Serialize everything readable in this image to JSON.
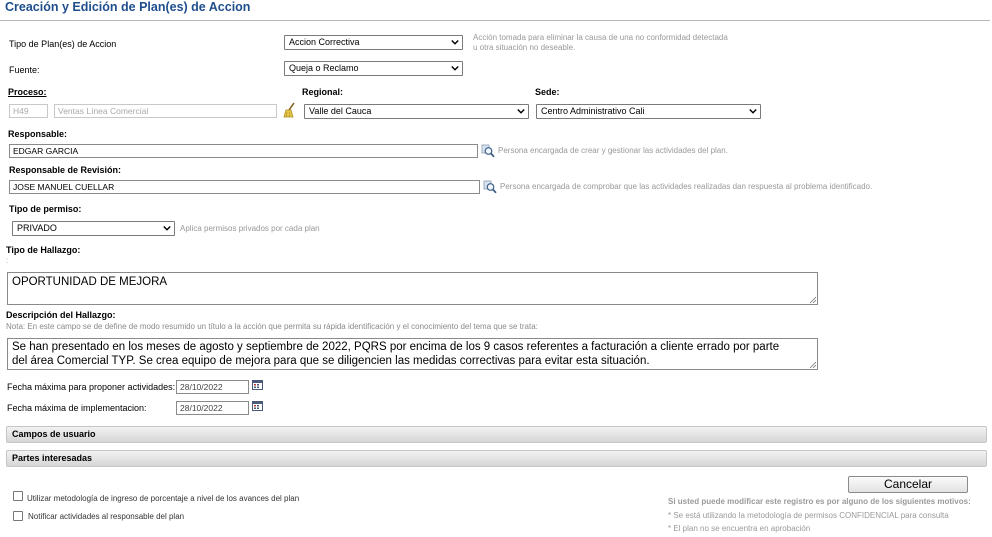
{
  "page_title": "Creación y Edición de Plan(es) de Accion",
  "tipo_plan": {
    "label": "Tipo de Plan(es) de Accion",
    "value": "Accion Correctiva",
    "hint_line1": "Acción tomada para eliminar la causa de una no conformidad detectada",
    "hint_line2": "u otra situación no deseable."
  },
  "fuente": {
    "label": "Fuente:",
    "value": "Queja o Reclamo"
  },
  "proceso": {
    "label": "Proceso:",
    "code": "H49",
    "name": "Ventas Línea Comercial"
  },
  "regional": {
    "label": "Regional:",
    "value": "Valle del Cauca"
  },
  "sede": {
    "label": "Sede:",
    "value": "Centro Administrativo Cali"
  },
  "responsable": {
    "label": "Responsable:",
    "value": "EDGAR GARCIA",
    "hint": "Persona encargada de crear y gestionar las actividades del plan."
  },
  "responsable_revision": {
    "label": "Responsable de Revisión:",
    "value": "JOSE MANUEL CUELLAR",
    "hint": "Persona encargada de comprobar que las actividades realizadas dan respuesta al problema identificado."
  },
  "tipo_permiso": {
    "label": "Tipo de permiso:",
    "value": "PRIVADO",
    "hint": "Aplica permisos privados por cada plan"
  },
  "tipo_hallazgo": {
    "label": "Tipo de Hallazgo:",
    "colon": ":",
    "value": "OPORTUNIDAD DE MEJORA"
  },
  "descripcion": {
    "label": "Descripción del Hallazgo:",
    "note": "Nota: En este campo se de define de modo resumido un título a la acción que permita su rápida identificación y el conocimiento del tema que se trata:",
    "line1": "Se han presentado en los meses de agosto y septiembre de 2022, PQRS por encima de los 9 casos referentes a facturación a cliente errado por parte",
    "line2": "del área Comercial TYP. Se crea equipo de mejora para que se diligencien las medidas correctivas para evitar esta situación."
  },
  "fecha_proponer": {
    "label": "Fecha máxima para proponer actividades:",
    "value": "28/10/2022"
  },
  "fecha_implementacion": {
    "label": "Fecha máxima de implementacion:",
    "value": "28/10/2022"
  },
  "sections": {
    "campos_usuario": "Campos de usuario",
    "partes_interesadas": "Partes interesadas"
  },
  "checkboxes": {
    "metodologia": "Utilizar metodología de ingreso de porcentaje a nivel de los avances del plan",
    "notificar": "Notificar actividades al responsable del plan"
  },
  "cancel_label": "Cancelar",
  "notice": {
    "title": "Si usted puede modificar este registro es por alguno de los siguientes motivos:",
    "item1": "* Se está utilizando la metodología de permisos CONFIDENCIAL para consulta",
    "item2": "* El plan no se encuentra en aprobación"
  },
  "colors": {
    "title": "#1f4e8c",
    "hint": "#999999"
  },
  "icons": {
    "dropdown": "chevron-down-icon",
    "search": "magnifier-icon",
    "clear": "broom-icon",
    "calendar": "calendar-icon"
  }
}
